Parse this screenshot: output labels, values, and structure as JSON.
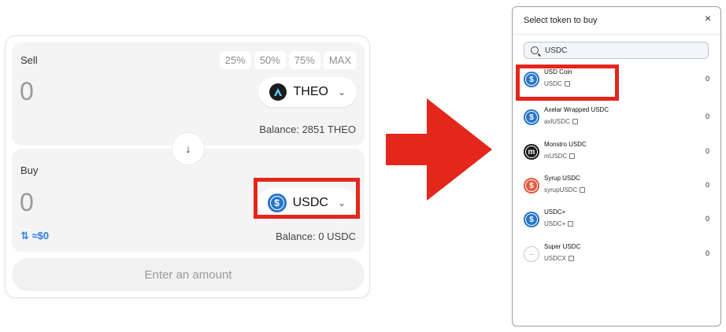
{
  "swap": {
    "sell": {
      "label": "Sell",
      "pct_options": [
        "25%",
        "50%",
        "75%",
        "MAX"
      ],
      "amount": "0",
      "token": "THEO",
      "balance": "Balance: 2851 THEO"
    },
    "buy": {
      "label": "Buy",
      "amount": "0",
      "token": "USDC",
      "fiat": "⇅ ≈$0",
      "balance": "Balance: 0 USDC"
    },
    "swap_arrow": "↓",
    "cta_label": "Enter an amount"
  },
  "modal": {
    "title": "Select token to buy",
    "close": "×",
    "search_value": "USDC",
    "tokens": [
      {
        "name": "USD Coin",
        "symbol": "USDC",
        "balance": "0",
        "icon": "usdc-icon",
        "color": "#2775ca"
      },
      {
        "name": "Axelar Wrapped USDC",
        "symbol": "axlUSDC",
        "balance": "0",
        "icon": "axlusdc-icon",
        "color": "#2775ca"
      },
      {
        "name": "Monstro USDC",
        "symbol": "mUSDC",
        "balance": "0",
        "icon": "musdc-icon",
        "color": "#1a1a1a"
      },
      {
        "name": "Syrup USDC",
        "symbol": "syrupUSDC",
        "balance": "0",
        "icon": "syrupusdc-icon",
        "color": "#e2593f"
      },
      {
        "name": "USDC+",
        "symbol": "USDC+",
        "balance": "0",
        "icon": "usdcplus-icon",
        "color": "#2775ca"
      },
      {
        "name": "Super USDC",
        "symbol": "USDCX",
        "balance": "0",
        "icon": "superusdc-icon",
        "color": "#c8c8c8"
      }
    ]
  },
  "colors": {
    "highlight": "#e5261b",
    "accent_blue": "#2d7ee8",
    "usdc_blue": "#2775ca"
  }
}
